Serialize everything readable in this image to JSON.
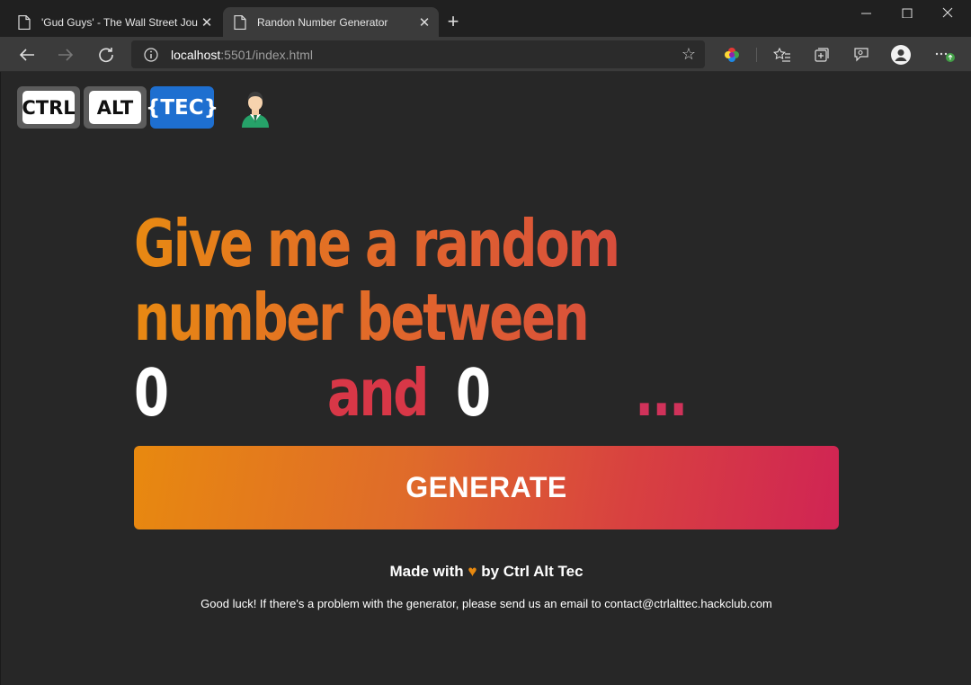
{
  "browser": {
    "tabs": [
      {
        "title": "'Gud Guys' - The Wall Street Jour",
        "active": false
      },
      {
        "title": "Randon Number Generator",
        "active": true
      }
    ],
    "url_host": "localhost",
    "url_rest": ":5501/index.html"
  },
  "logo": {
    "key1": "CTRL",
    "key2": "ALT",
    "key3": "{TEC}"
  },
  "headline": {
    "line1": "Give me a random",
    "line2": "number between",
    "min_value": "0",
    "and_word": "and",
    "max_value": "0",
    "ellipsis": "..."
  },
  "button": {
    "label": "GENERATE"
  },
  "footer": {
    "made_prefix": "Made with",
    "heart": "♥",
    "made_suffix": "by Ctrl Alt Tec",
    "note": "Good luck! If there's a problem with the generator, please send us an email to contact@ctrlalttec.hackclub.com"
  },
  "colors": {
    "accent_orange": "#e8890f",
    "accent_red": "#d83747",
    "accent_pink": "#d02454",
    "page_bg": "#272727"
  }
}
